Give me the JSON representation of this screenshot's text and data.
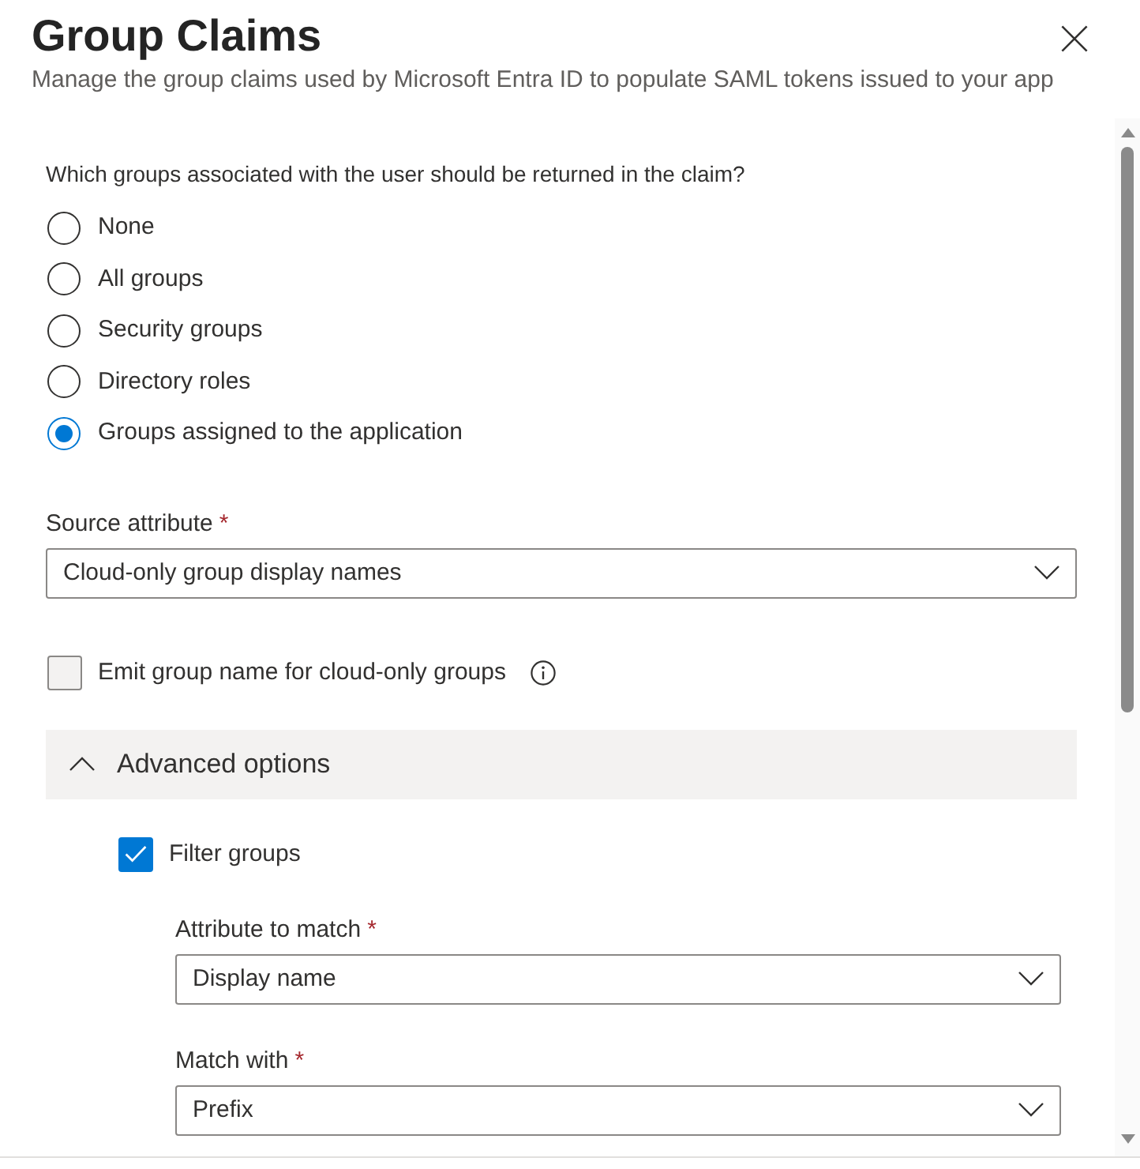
{
  "header": {
    "title": "Group Claims",
    "subtitle": "Manage the group claims used by Microsoft Entra ID to populate SAML tokens issued to your app"
  },
  "groups_question": {
    "label": "Which groups associated with the user should be returned in the claim?",
    "options": [
      {
        "label": "None",
        "selected": false
      },
      {
        "label": "All groups",
        "selected": false
      },
      {
        "label": "Security groups",
        "selected": false
      },
      {
        "label": "Directory roles",
        "selected": false
      },
      {
        "label": "Groups assigned to the application",
        "selected": true
      }
    ]
  },
  "source_attribute": {
    "label": "Source attribute",
    "required_mark": "*",
    "value": "Cloud-only group display names"
  },
  "emit_group_name": {
    "label": "Emit group name for cloud-only groups",
    "checked": false
  },
  "advanced_options": {
    "label": "Advanced options",
    "expanded": true,
    "filter_groups": {
      "label": "Filter groups",
      "checked": true
    },
    "fields": [
      {
        "label": "Attribute to match",
        "required_mark": "*",
        "value": "Display name"
      },
      {
        "label": "Match with",
        "required_mark": "*",
        "value": "Prefix"
      }
    ]
  }
}
